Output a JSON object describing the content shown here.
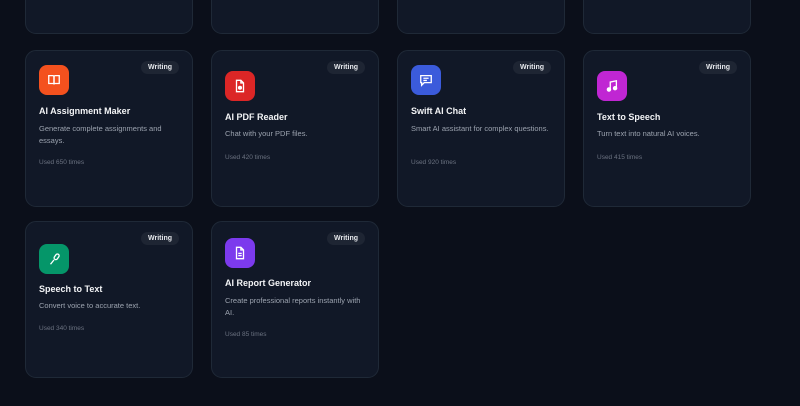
{
  "top_cards": [
    {},
    {},
    {},
    {}
  ],
  "tools": [
    {
      "title": "AI Assignment Maker",
      "badge": "Writing",
      "description": "Generate complete assignments and essays.",
      "usage": "Used 650 times",
      "icon": "book-icon",
      "color": "#f4511e"
    },
    {
      "title": "AI PDF Reader",
      "badge": "Writing",
      "description": "Chat with your PDF files.",
      "usage": "Used 420 times",
      "icon": "pdf-file-icon",
      "color": "#dc2626"
    },
    {
      "title": "Swift AI Chat",
      "badge": "Writing",
      "description": "Smart AI assistant for complex questions.",
      "usage": "Used 920 times",
      "icon": "chat-icon",
      "color": "#3b5bdb"
    },
    {
      "title": "Text to Speech",
      "badge": "Writing",
      "description": "Turn text into natural AI voices.",
      "usage": "Used 415 times",
      "icon": "music-note-icon",
      "color": "#c026d3"
    },
    {
      "title": "Speech to Text",
      "badge": "Writing",
      "description": "Convert voice to accurate text.",
      "usage": "Used 340 times",
      "icon": "microphone-icon",
      "color": "#059669"
    },
    {
      "title": "AI Report Generator",
      "badge": "Writing",
      "description": "Create professional reports instantly with AI.",
      "usage": "Used 85 times",
      "icon": "document-icon",
      "color": "#7c3aed"
    }
  ]
}
